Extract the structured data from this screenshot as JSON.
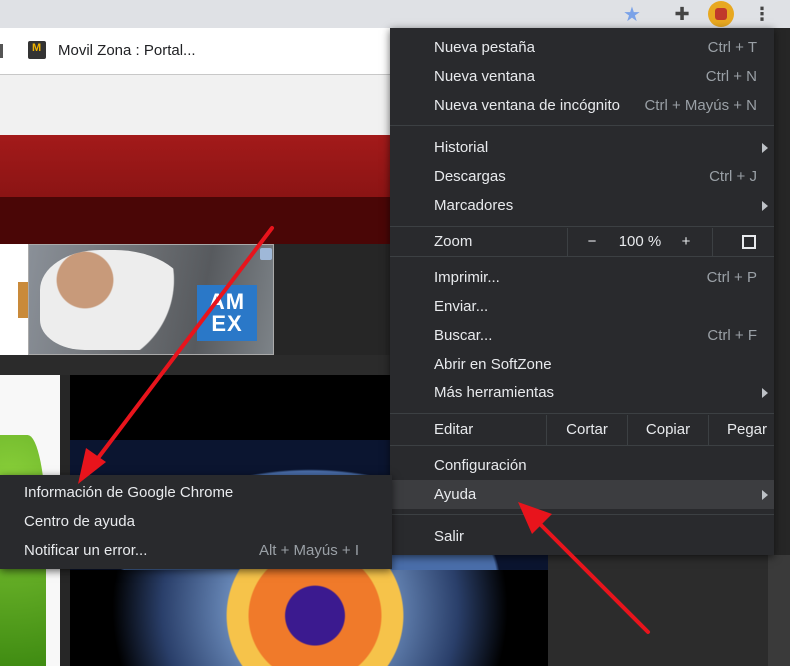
{
  "toolbar": {
    "icons": [
      "star-icon",
      "puzzle-icon",
      "avatar",
      "kebab-menu-icon"
    ]
  },
  "bookmarks": {
    "item_label": "Movil Zona : Portal..."
  },
  "ad": {
    "amex_text": "AM\nEX"
  },
  "main_menu": {
    "new_tab": {
      "label": "Nueva pestaña",
      "shortcut": "Ctrl + T"
    },
    "new_window": {
      "label": "Nueva ventana",
      "shortcut": "Ctrl + N"
    },
    "incognito": {
      "label": "Nueva ventana de incógnito",
      "shortcut": "Ctrl + Mayús + N"
    },
    "history": {
      "label": "Historial"
    },
    "downloads": {
      "label": "Descargas",
      "shortcut": "Ctrl + J"
    },
    "bookmarks": {
      "label": "Marcadores"
    },
    "zoom": {
      "label": "Zoom",
      "minus": "−",
      "value": "100 %",
      "plus": "+"
    },
    "print": {
      "label": "Imprimir...",
      "shortcut": "Ctrl + P"
    },
    "send": {
      "label": "Enviar..."
    },
    "find": {
      "label": "Buscar...",
      "shortcut": "Ctrl + F"
    },
    "open_in": {
      "label": "Abrir en SoftZone"
    },
    "more_tools": {
      "label": "Más herramientas"
    },
    "edit": {
      "label": "Editar",
      "cut": "Cortar",
      "copy": "Copiar",
      "paste": "Pegar"
    },
    "settings": {
      "label": "Configuración"
    },
    "help": {
      "label": "Ayuda"
    },
    "exit": {
      "label": "Salir"
    }
  },
  "help_menu": {
    "about": {
      "label": "Información de Google Chrome"
    },
    "help_center": {
      "label": "Centro de ayuda"
    },
    "report": {
      "label": "Notificar un error...",
      "shortcut": "Alt + Mayús + I"
    }
  },
  "colors": {
    "menu_bg": "#292a2d",
    "menu_text": "#e8eaed",
    "shortcut_text": "#9aa0a6",
    "highlight": "#3c3d40",
    "annotation_arrow": "#e8141c"
  }
}
